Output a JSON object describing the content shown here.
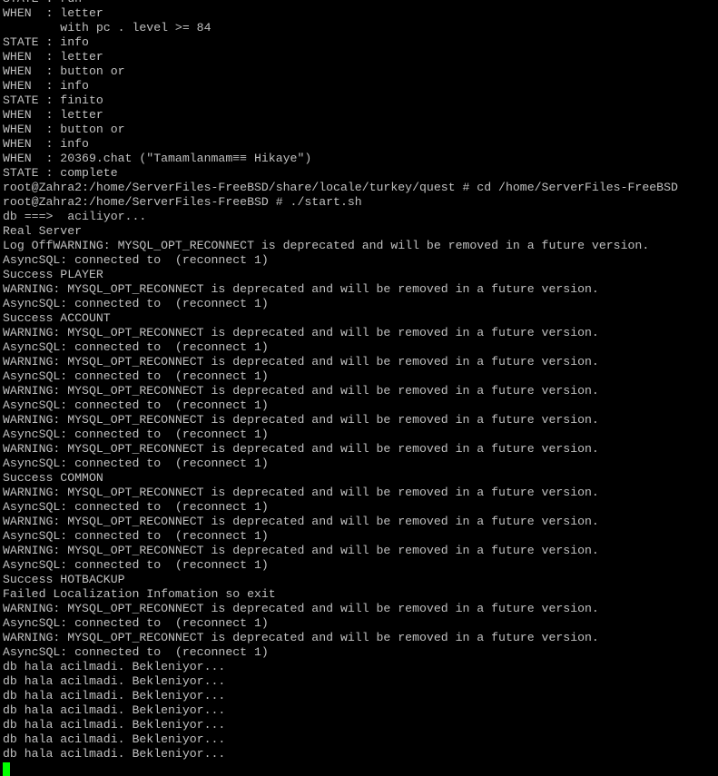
{
  "terminal": {
    "lines": [
      "STATE : run",
      "WHEN  : letter",
      "        with pc . level >= 84",
      "STATE : info",
      "WHEN  : letter",
      "WHEN  : button or",
      "WHEN  : info",
      "STATE : finito",
      "WHEN  : letter",
      "WHEN  : button or",
      "WHEN  : info",
      "WHEN  : 20369.chat (\"Tamamlanmam≡≡ Hikaye\")",
      "STATE : complete",
      "root@Zahra2:/home/ServerFiles-FreeBSD/share/locale/turkey/quest # cd /home/ServerFiles-FreeBSD",
      "root@Zahra2:/home/ServerFiles-FreeBSD # ./start.sh",
      "db ===>  aciliyor...",
      "Real Server",
      "Log OffWARNING: MYSQL_OPT_RECONNECT is deprecated and will be removed in a future version.",
      "AsyncSQL: connected to  (reconnect 1)",
      "Success PLAYER",
      "WARNING: MYSQL_OPT_RECONNECT is deprecated and will be removed in a future version.",
      "AsyncSQL: connected to  (reconnect 1)",
      "Success ACCOUNT",
      "WARNING: MYSQL_OPT_RECONNECT is deprecated and will be removed in a future version.",
      "AsyncSQL: connected to  (reconnect 1)",
      "WARNING: MYSQL_OPT_RECONNECT is deprecated and will be removed in a future version.",
      "AsyncSQL: connected to  (reconnect 1)",
      "WARNING: MYSQL_OPT_RECONNECT is deprecated and will be removed in a future version.",
      "AsyncSQL: connected to  (reconnect 1)",
      "WARNING: MYSQL_OPT_RECONNECT is deprecated and will be removed in a future version.",
      "AsyncSQL: connected to  (reconnect 1)",
      "WARNING: MYSQL_OPT_RECONNECT is deprecated and will be removed in a future version.",
      "AsyncSQL: connected to  (reconnect 1)",
      "Success COMMON",
      "WARNING: MYSQL_OPT_RECONNECT is deprecated and will be removed in a future version.",
      "AsyncSQL: connected to  (reconnect 1)",
      "WARNING: MYSQL_OPT_RECONNECT is deprecated and will be removed in a future version.",
      "AsyncSQL: connected to  (reconnect 1)",
      "WARNING: MYSQL_OPT_RECONNECT is deprecated and will be removed in a future version.",
      "AsyncSQL: connected to  (reconnect 1)",
      "Success HOTBACKUP",
      "Failed Localization Infomation so exit",
      "WARNING: MYSQL_OPT_RECONNECT is deprecated and will be removed in a future version.",
      "AsyncSQL: connected to  (reconnect 1)",
      "WARNING: MYSQL_OPT_RECONNECT is deprecated and will be removed in a future version.",
      "AsyncSQL: connected to  (reconnect 1)",
      "db hala acilmadi. Bekleniyor...",
      "db hala acilmadi. Bekleniyor...",
      "db hala acilmadi. Bekleniyor...",
      "db hala acilmadi. Bekleniyor...",
      "db hala acilmadi. Bekleniyor...",
      "db hala acilmadi. Bekleniyor...",
      "db hala acilmadi. Bekleniyor..."
    ],
    "colors": {
      "background": "#000000",
      "text": "#c0c0c0",
      "cursor": "#00ff00"
    }
  }
}
